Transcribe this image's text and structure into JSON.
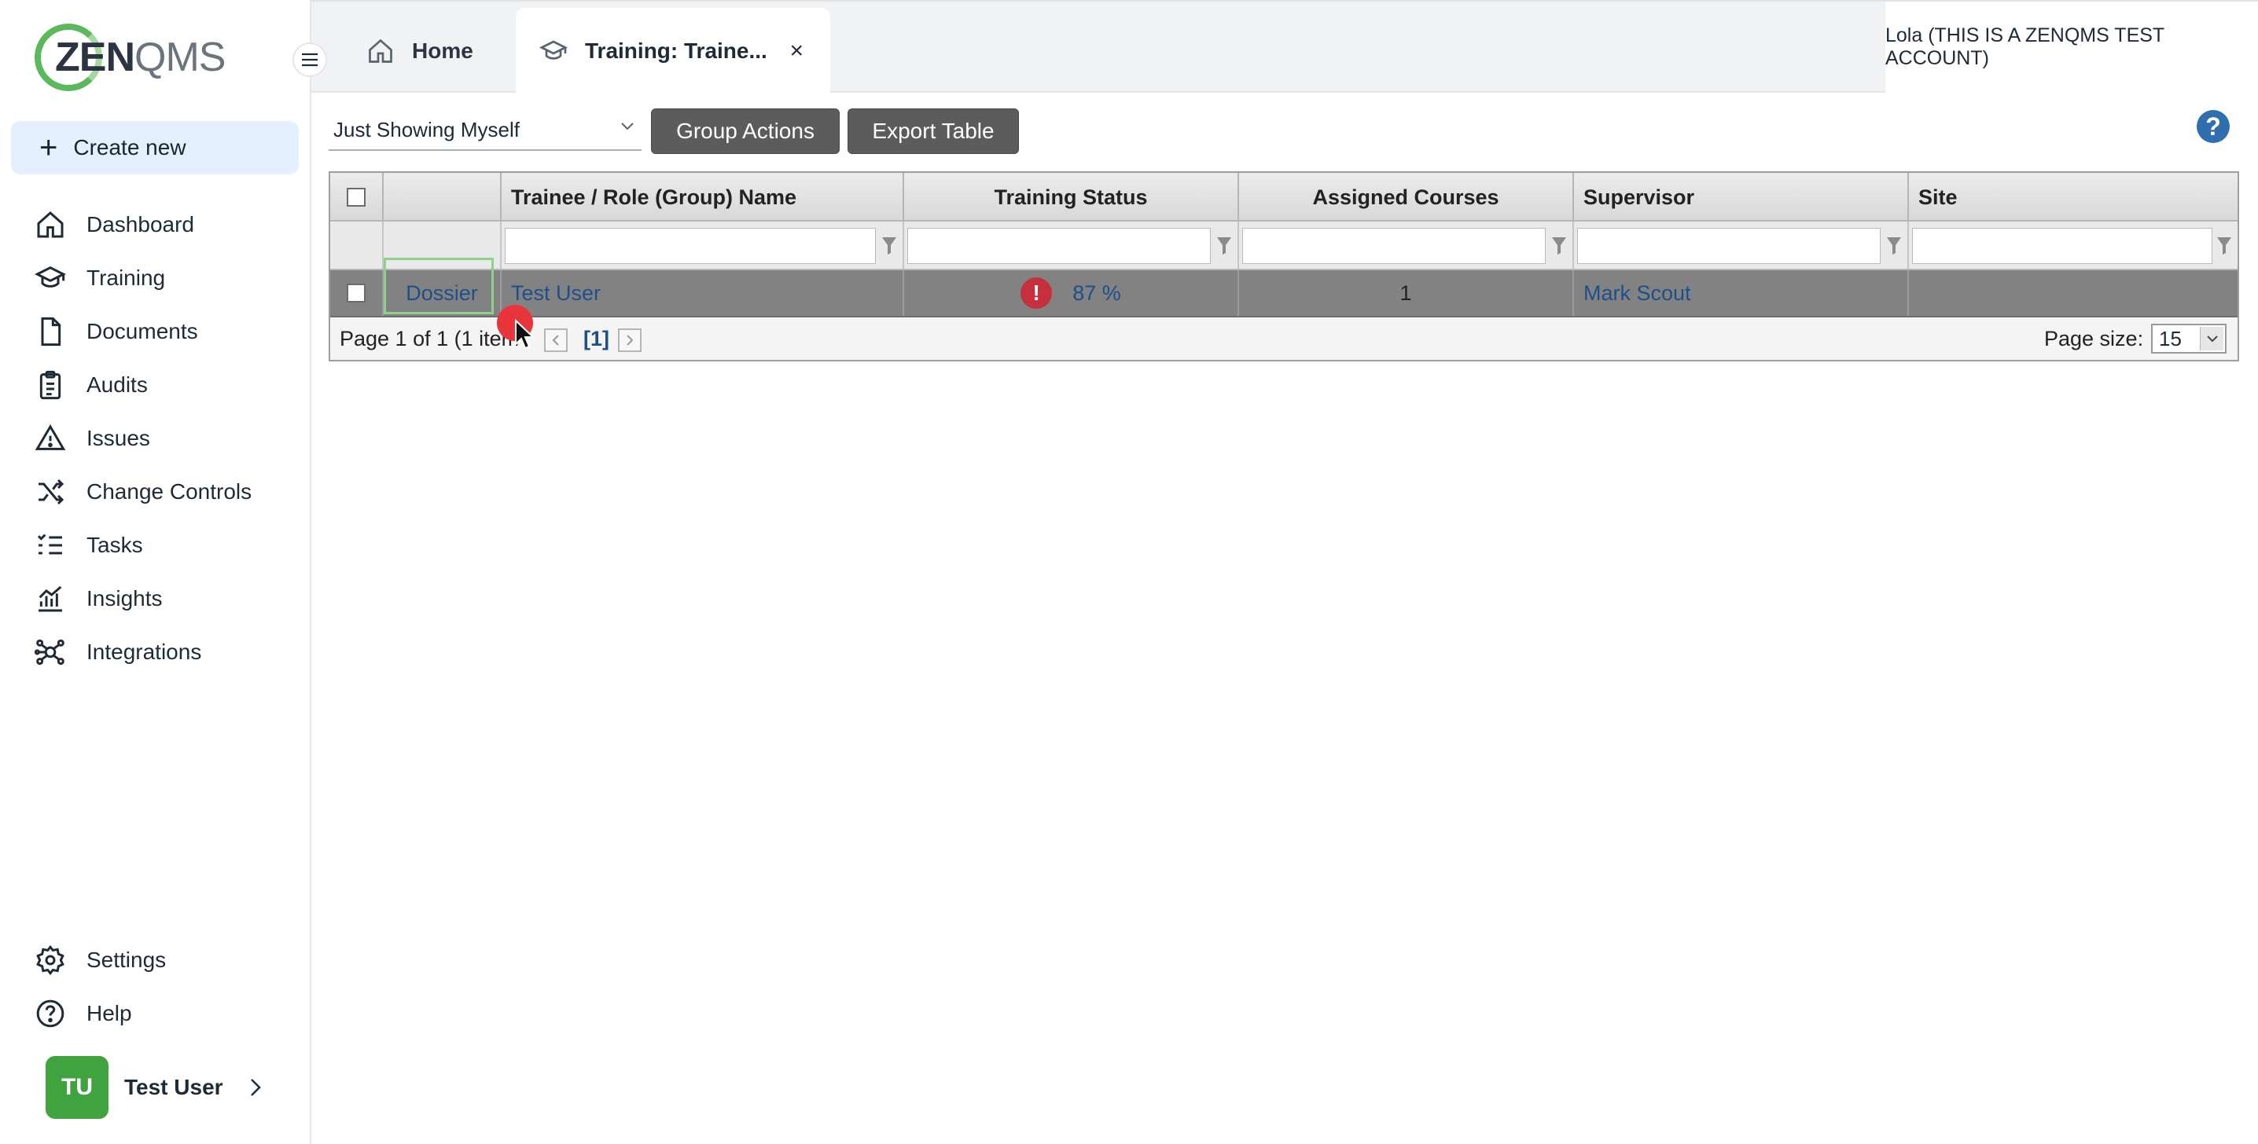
{
  "brand": {
    "logo_zen": "ZEN",
    "logo_qms": "QMS",
    "accent": "#5cb85c"
  },
  "sidebar": {
    "create_new_label": "Create new",
    "items": [
      {
        "label": "Dashboard",
        "icon": "home-icon"
      },
      {
        "label": "Training",
        "icon": "graduation-cap-icon"
      },
      {
        "label": "Documents",
        "icon": "document-icon"
      },
      {
        "label": "Audits",
        "icon": "clipboard-icon"
      },
      {
        "label": "Issues",
        "icon": "warning-icon"
      },
      {
        "label": "Change Controls",
        "icon": "shuffle-icon"
      },
      {
        "label": "Tasks",
        "icon": "checklist-icon"
      },
      {
        "label": "Insights",
        "icon": "chart-icon"
      },
      {
        "label": "Integrations",
        "icon": "network-icon"
      }
    ],
    "bottom_items": [
      {
        "label": "Settings",
        "icon": "gear-icon"
      },
      {
        "label": "Help",
        "icon": "question-icon"
      }
    ],
    "user": {
      "initials": "TU",
      "name": "Test User"
    }
  },
  "tabs": {
    "home_label": "Home",
    "active_label": "Training: Traine...",
    "close_glyph": "×"
  },
  "account_label": "Lola (THIS IS A ZENQMS TEST ACCOUNT)",
  "toolbar": {
    "filter_value": "Just Showing Myself",
    "group_actions_label": "Group Actions",
    "export_label": "Export Table",
    "help_glyph": "?"
  },
  "grid": {
    "columns": [
      "Trainee / Role (Group) Name",
      "Training Status",
      "Assigned Courses",
      "Supervisor",
      "Site"
    ],
    "rows": [
      {
        "action": "Dossier",
        "name": "Test User",
        "status_glyph": "!",
        "status": "87 %",
        "assigned_courses": "1",
        "supervisor": "Mark Scout",
        "site": ""
      }
    ],
    "pager": {
      "text": "Page 1 of 1 (1 item",
      "current_page": "[1]",
      "page_size_label": "Page size:",
      "page_size_value": "15"
    }
  }
}
